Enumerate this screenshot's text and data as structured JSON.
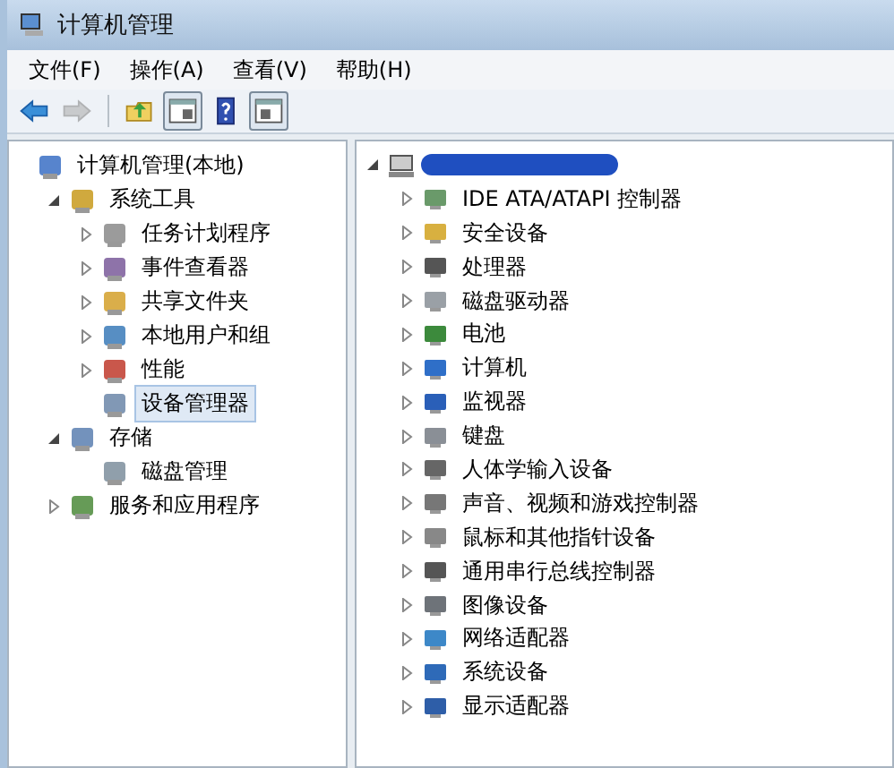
{
  "window": {
    "title": "计算机管理"
  },
  "menu": [
    "文件(F)",
    "操作(A)",
    "查看(V)",
    "帮助(H)"
  ],
  "toolbar": [
    [
      {
        "kind": "back",
        "disabled": false,
        "pressed": false
      },
      {
        "kind": "forward",
        "disabled": true,
        "pressed": false
      }
    ],
    [
      {
        "kind": "up",
        "disabled": false,
        "pressed": false
      },
      {
        "kind": "console-tree",
        "disabled": false,
        "pressed": true
      },
      {
        "kind": "help",
        "disabled": false,
        "pressed": false
      },
      {
        "kind": "action-pane",
        "disabled": false,
        "pressed": true
      }
    ]
  ],
  "console_tree": [
    {
      "label": "计算机管理(本地)",
      "kind": "leaf",
      "selected": false,
      "children": [
        {
          "label": "系统工具",
          "kind": "branch",
          "expanded": true,
          "selected": false,
          "children": [
            {
              "label": "任务计划程序",
              "kind": "branch",
              "expanded": false,
              "selected": false
            },
            {
              "label": "事件查看器",
              "kind": "branch",
              "expanded": false,
              "selected": false
            },
            {
              "label": "共享文件夹",
              "kind": "branch",
              "expanded": false,
              "selected": false
            },
            {
              "label": "本地用户和组",
              "kind": "branch",
              "expanded": false,
              "selected": false
            },
            {
              "label": "性能",
              "kind": "branch",
              "expanded": false,
              "selected": false
            },
            {
              "label": "设备管理器",
              "kind": "leaf",
              "selected": true
            }
          ]
        },
        {
          "label": "存储",
          "kind": "branch",
          "expanded": true,
          "selected": false,
          "children": [
            {
              "label": "磁盘管理",
              "kind": "leaf",
              "selected": false
            }
          ]
        },
        {
          "label": "服务和应用程序",
          "kind": "branch",
          "expanded": false,
          "selected": false
        }
      ]
    }
  ],
  "device_tree": {
    "root": {
      "expanded": true
    },
    "categories": [
      {
        "label": "IDE ATA/ATAPI 控制器",
        "expanded": false
      },
      {
        "label": "安全设备",
        "expanded": false
      },
      {
        "label": "处理器",
        "expanded": false
      },
      {
        "label": "磁盘驱动器",
        "expanded": false
      },
      {
        "label": "电池",
        "expanded": false
      },
      {
        "label": "计算机",
        "expanded": false
      },
      {
        "label": "监视器",
        "expanded": false
      },
      {
        "label": "键盘",
        "expanded": false
      },
      {
        "label": "人体学输入设备",
        "expanded": false
      },
      {
        "label": "声音、视频和游戏控制器",
        "expanded": false
      },
      {
        "label": "鼠标和其他指针设备",
        "expanded": false
      },
      {
        "label": "通用串行总线控制器",
        "expanded": false
      },
      {
        "label": "图像设备",
        "expanded": false
      },
      {
        "label": "网络适配器",
        "expanded": false
      },
      {
        "label": "系统设备",
        "expanded": false
      },
      {
        "label": "显示适配器",
        "expanded": false
      }
    ]
  }
}
